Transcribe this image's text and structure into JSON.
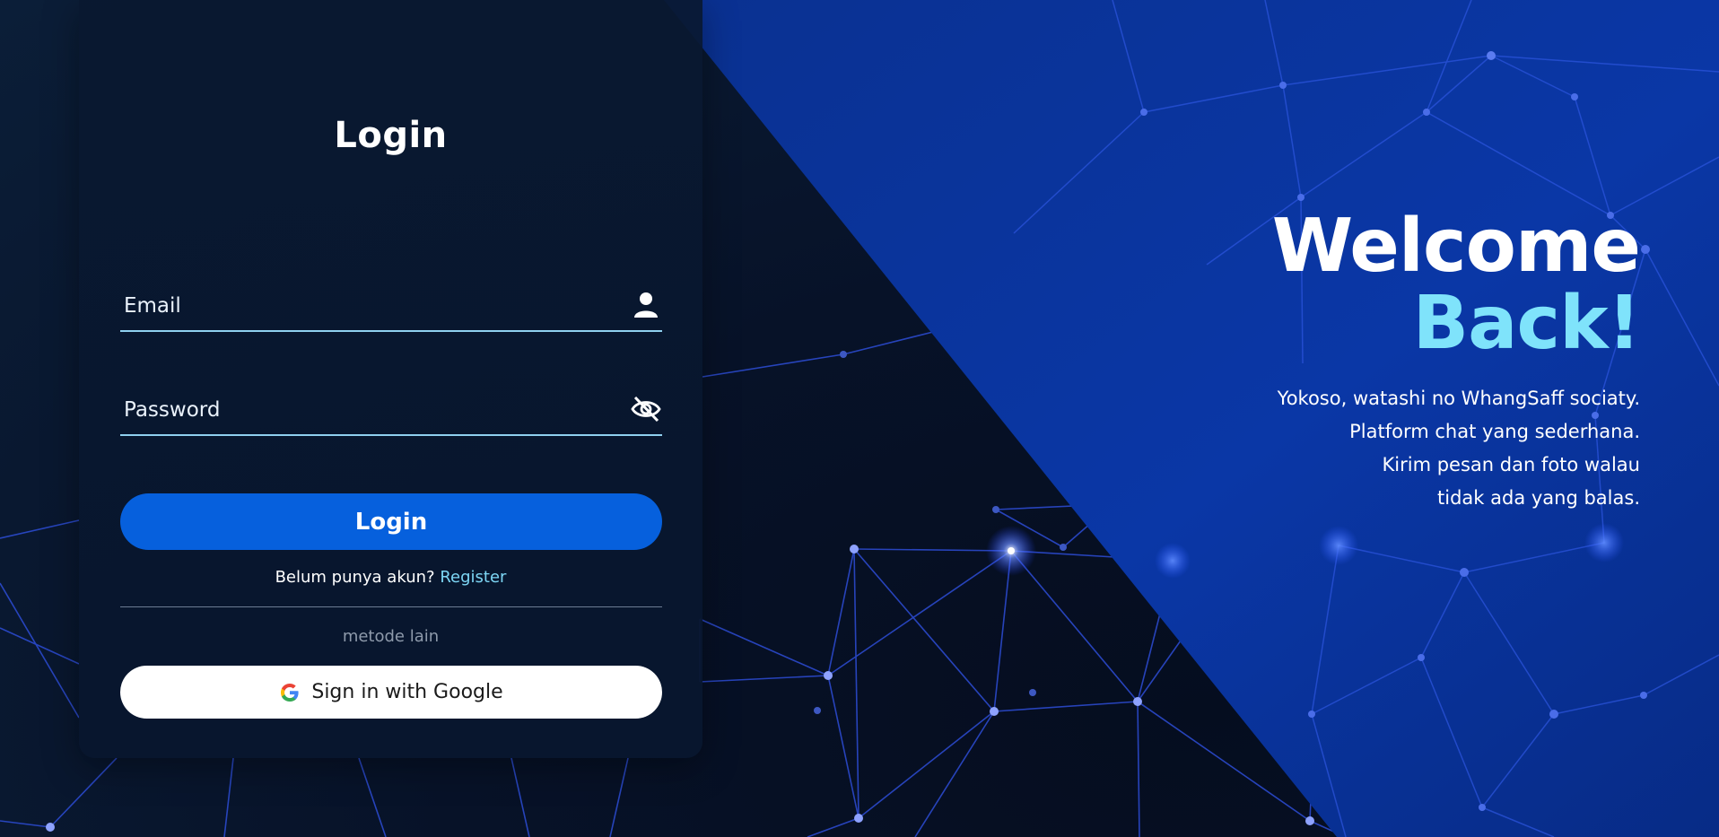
{
  "login_card": {
    "title": "Login",
    "email_placeholder": "Email",
    "password_placeholder": "Password",
    "login_button": "Login",
    "register_prompt": "Belum punya akun?",
    "register_link": "Register",
    "alt_methods_label": "metode lain",
    "google_button": "Sign in with Google",
    "icons": {
      "email": "user-icon",
      "password": "eye-slash-icon",
      "google": "google-icon"
    }
  },
  "welcome": {
    "line1": "Welcome",
    "line2": "Back!",
    "description": [
      "Yokoso, watashi no WhangSaff sociaty.",
      "Platform chat yang sederhana.",
      "Kirim pesan dan foto walau",
      "tidak ada yang balas."
    ]
  },
  "colors": {
    "primary_button": "#0660dd",
    "accent_cyan": "#7fe3fb",
    "link": "#7dd6f5",
    "field_underline": "#8fd0ef",
    "diagonal_blue": "#0a35a0",
    "background_dark": "#071228"
  }
}
